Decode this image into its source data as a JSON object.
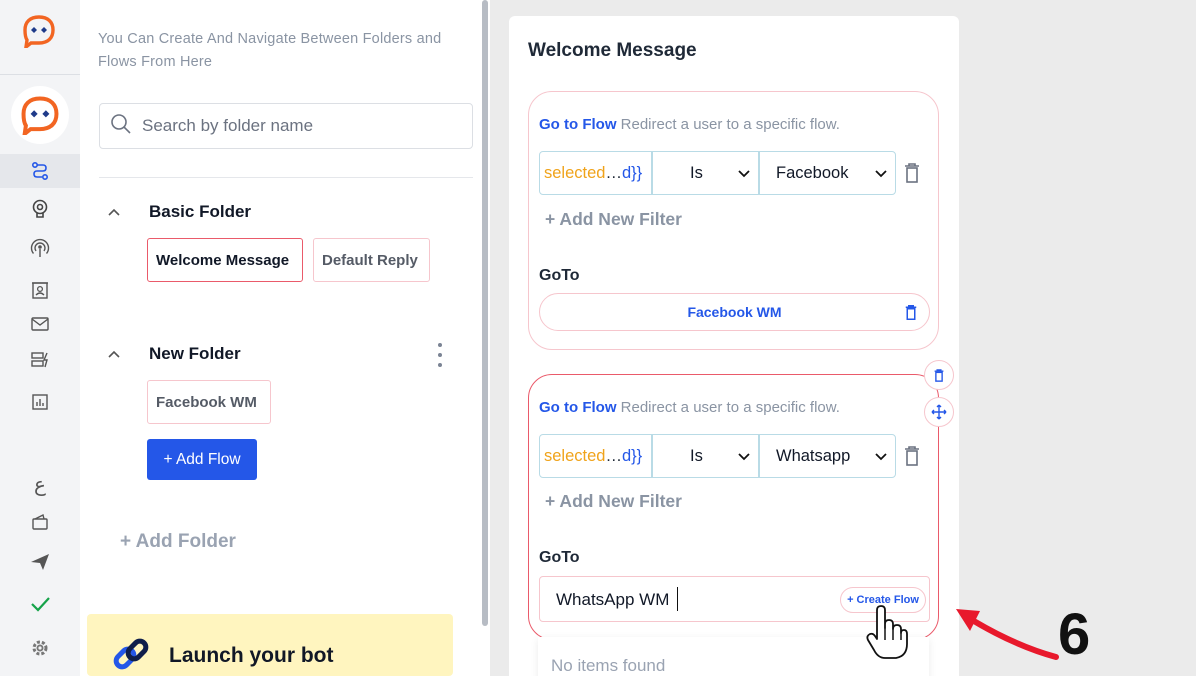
{
  "sidebar": {
    "nav_icons": [
      "flow-icon",
      "bot-icon",
      "broadcast-icon",
      "contacts-icon",
      "mail-icon",
      "automation-icon",
      "analytics-icon"
    ],
    "bottom_icons": [
      "arabic-language-icon",
      "wallet-icon",
      "send-icon",
      "check-icon",
      "settings-icon"
    ],
    "brand_color": "#f26522"
  },
  "folders_panel": {
    "hint": "You Can Create And Navigate Between Folders and Flows From Here",
    "search_placeholder": "Search by folder name",
    "folders": [
      {
        "name": "Basic Folder",
        "flows": [
          "Welcome Message",
          "Default Reply"
        ]
      },
      {
        "name": "New Folder",
        "flows": [
          "Facebook WM"
        ]
      }
    ],
    "add_flow_label": "+ Add Flow",
    "add_folder_label": "+ Add Folder",
    "launch_label": "Launch your bot"
  },
  "editor": {
    "title": "Welcome Message",
    "steps": [
      {
        "action": "Go to Flow",
        "action_desc": "Redirect a user to a specific flow.",
        "filter_var_start": "selected",
        "filter_var_ellipsis": "…",
        "filter_var_end": "d}}",
        "filter_operator": "Is",
        "filter_value": "Facebook",
        "add_filter_label": "+ Add New Filter",
        "goto_label": "GoTo",
        "goto_value": "Facebook WM"
      },
      {
        "action": "Go to Flow",
        "action_desc": "Redirect a user to a specific flow.",
        "filter_var_start": "selected",
        "filter_var_ellipsis": "…",
        "filter_var_end": "d}}",
        "filter_operator": "Is",
        "filter_value": "Whatsapp",
        "add_filter_label": "+ Add New Filter",
        "goto_label": "GoTo",
        "goto_input_value": "WhatsApp WM",
        "create_flow_label": "+ Create Flow",
        "dropdown_text": "No items found"
      }
    ]
  },
  "annotation": {
    "step_number": "6",
    "arrow_color": "#e8192c"
  },
  "colors": {
    "accent_blue": "#2457e8",
    "variable_orange": "#f0a31a",
    "active_border": "#ea5a6a"
  }
}
